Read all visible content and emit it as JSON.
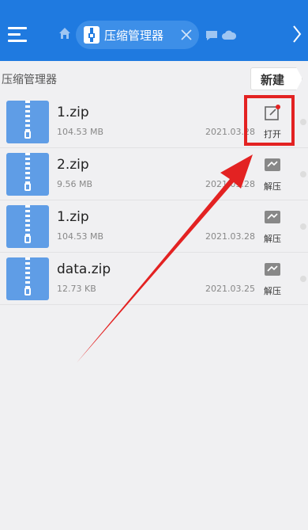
{
  "header": {
    "menu_icon": "hamburger-menu-icon",
    "home_icon": "home-icon",
    "tab": {
      "label": "压缩管理器",
      "icon": "zip-file-icon",
      "close_icon": "close-icon"
    },
    "extra_icons": [
      "chat-icon",
      "cloud-icon",
      "window-icon"
    ]
  },
  "path": {
    "label": "压缩管理器",
    "new_button": "新建"
  },
  "files": [
    {
      "name": "1.zip",
      "size": "104.53 MB",
      "date": "2021.03.28",
      "action": "打开",
      "action_icon": "open-edit-icon"
    },
    {
      "name": "2.zip",
      "size": "9.56 MB",
      "date": "2021.03.28",
      "action": "解压",
      "action_icon": "extract-icon"
    },
    {
      "name": "1.zip",
      "size": "104.53 MB",
      "date": "2021.03.28",
      "action": "解压",
      "action_icon": "extract-icon"
    },
    {
      "name": "data.zip",
      "size": "12.73 KB",
      "date": "2021.03.25",
      "action": "解压",
      "action_icon": "extract-icon"
    }
  ],
  "annotation": {
    "color": "#e32222",
    "shape": "red-arrow"
  },
  "colors": {
    "topbar": "#1f7ae0",
    "zip_icon": "#5f9de6",
    "background": "#f0f0f2"
  }
}
